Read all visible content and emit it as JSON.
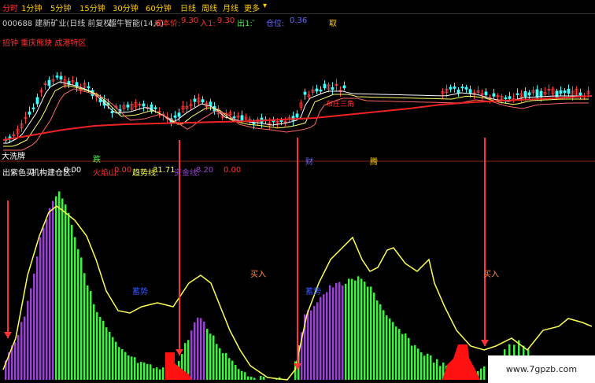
{
  "toolbar": {
    "tabs": [
      "分时",
      "1分钟",
      "5分钟",
      "15分钟",
      "30分钟",
      "60分钟",
      "日线",
      "周线",
      "月线",
      "更多"
    ],
    "more_arrow": "▾",
    "active_index": 0
  },
  "main_info": {
    "stock": "000688 建新矿业(日线 前复权)",
    "indicator": "超牛智能(14,6)",
    "cost_label": "成本价:",
    "cost_value": "9.30",
    "buy_label": "入1:",
    "buy_value": "9.30",
    "out_label": "出1:",
    "out_value": "-",
    "position_label": "仓位: ",
    "position_value": "0.36",
    "cut_text": "取"
  },
  "subtitle": "招钟 重庆熊炔 成港特区",
  "price_labels": {
    "top_label": "大洗牌",
    "down_label": "跌",
    "cai_label": "财",
    "teng_label": "腾",
    "mid_label": "布庄三角"
  },
  "sub_info": {
    "title": "出紫色买",
    "jg_label": "机构建仓区:",
    "jg_value": "0.00",
    "fire_label": "火焰山:",
    "fire_value": "0.00",
    "trend_label": "趋势线:",
    "trend_value": "31.71",
    "flag_label": "资金线:",
    "flag_value": "8.20",
    "extra_value": "0.00"
  },
  "sub_labels": {
    "buy1": "买入",
    "buy2": "买入",
    "blue1": "蓄势",
    "blue2": "蓄势"
  },
  "watermark": "www.7gpzb.com",
  "colors": {
    "up": "#ff4040",
    "down": "#40ffff",
    "yellow": "#ffff55",
    "green": "#44ee44",
    "purple": "#9944cc",
    "red": "#ff1111"
  }
}
